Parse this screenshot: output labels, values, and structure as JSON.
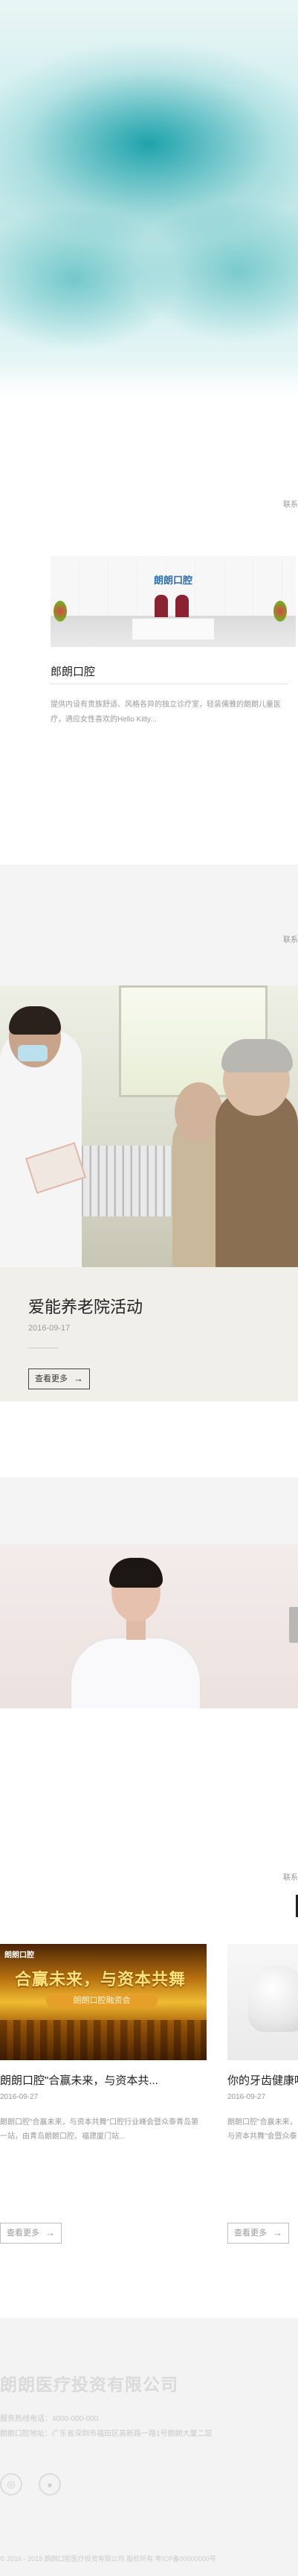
{
  "hero": {
    "label": ""
  },
  "sections": {
    "intro_tag": "联系",
    "activity_tag": "联系",
    "news_tag": "联系"
  },
  "clinic": {
    "logo_text": "朗朗口腔",
    "title": "郎朗口腔",
    "description": "提供内设有贵族舒适、风格各异的独立诊疗室，轻装儒雅的朗朗儿童医疗，適应女性喜欢的Hello Kitty..."
  },
  "activity": {
    "title": "爱能养老院活动",
    "date": "2016-09-17",
    "more_label": "查看更多",
    "arrow": "→"
  },
  "news": [
    {
      "image_text": "朗朗口腔",
      "image_banner": "合赢未来，与资本共舞",
      "image_sub": "朗朗口腔融资会",
      "title": "朗朗口腔\"合赢未来，与资本共...",
      "date": "2016-09-27",
      "desc": "朗朗口腔\"合赢未来，与资本共舞\"口腔行业峰会暨众泰青岛第一站，由青岛朗朗口腔、福建厦门站...",
      "more_label": "查看更多"
    },
    {
      "title": "你的牙齿健康吗",
      "date": "2016-09-27",
      "desc": "朗朗口腔\"合赢未来，与资本共舞\"会暨众泰青岛第一站...",
      "more_label": "查看更多"
    }
  ],
  "footer": {
    "company": "朗朗医疗投资有限公司",
    "phone": "服务热线电话：4000-000-000",
    "address": "朗朗口腔地址：广东省深圳市福田区高新路一路1号朗朗大厦二层",
    "social_icons": [
      "weibo-icon",
      "wechat-icon"
    ],
    "copyright": "© 2016 - 2018 朗朗口腔医疗投资有限公司 版权所有 粤ICP备00000000号"
  }
}
